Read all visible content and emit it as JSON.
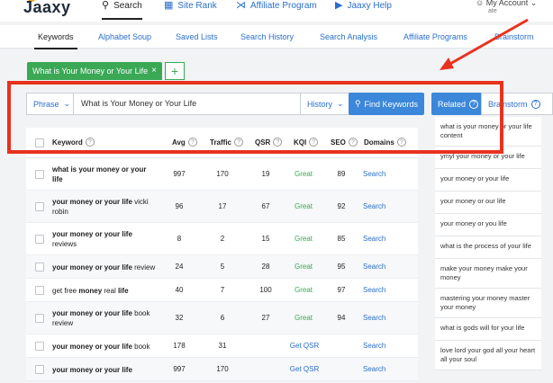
{
  "brand": {
    "name": "Jaaxy"
  },
  "topnav": [
    {
      "label": "Search",
      "icon": "search-icon",
      "active": true
    },
    {
      "label": "Site Rank",
      "icon": "bar-chart-icon",
      "active": false
    },
    {
      "label": "Affiliate Program",
      "icon": "share-icon",
      "active": false
    },
    {
      "label": "Jaaxy Help",
      "icon": "play-circle-icon",
      "active": false
    }
  ],
  "account": {
    "label": "My Account",
    "sub": "ate"
  },
  "subnav": [
    {
      "label": "Keywords",
      "active": true
    },
    {
      "label": "Alphabet Soup"
    },
    {
      "label": "Saved Lists"
    },
    {
      "label": "Search History"
    },
    {
      "label": "Search Analysis"
    },
    {
      "label": "Affiliate Programs"
    },
    {
      "label": "Brainstorm"
    }
  ],
  "query_tab": {
    "label": "What is Your Money or Your Life",
    "close": "×",
    "add": "+"
  },
  "search": {
    "mode": "Phrase",
    "value": "What is Your Money or Your Life",
    "history": "History",
    "button": "Find Keywords"
  },
  "side_tabs": {
    "related": "Related",
    "brainstorm": "Brainstorm"
  },
  "table": {
    "headers": {
      "keyword": "Keyword",
      "avg": "Avg",
      "traffic": "Traffic",
      "qsr": "QSR",
      "kqi": "KQI",
      "seo": "SEO",
      "domains": "Domains"
    },
    "rows": [
      {
        "kw_bold": "what is your money or your life",
        "kw_plain": "",
        "avg": "997",
        "traffic": "170",
        "qsr": "19",
        "kqi": "Great",
        "seo": "89",
        "domains": "Search"
      },
      {
        "kw_bold": "your money or your life",
        "kw_plain": " vicki robin",
        "avg": "96",
        "traffic": "17",
        "qsr": "67",
        "kqi": "Great",
        "seo": "92",
        "domains": "Search"
      },
      {
        "kw_bold": "your money or your life",
        "kw_plain": " reviews",
        "avg": "8",
        "traffic": "2",
        "qsr": "15",
        "kqi": "Great",
        "seo": "85",
        "domains": "Search"
      },
      {
        "kw_bold": "your money or your life",
        "kw_plain": " review",
        "avg": "24",
        "traffic": "5",
        "qsr": "28",
        "kqi": "Great",
        "seo": "95",
        "domains": "Search"
      },
      {
        "kw_pre": "get free ",
        "kw_bold": "money",
        "kw_mid": " real ",
        "kw_bold2": "life",
        "avg": "40",
        "traffic": "7",
        "qsr": "100",
        "kqi": "Great",
        "seo": "97",
        "domains": "Search"
      },
      {
        "kw_bold": "your money or your life",
        "kw_plain": " book review",
        "avg": "32",
        "traffic": "6",
        "qsr": "27",
        "kqi": "Great",
        "seo": "94",
        "domains": "Search"
      },
      {
        "kw_bold": "your money or your life",
        "kw_plain": " book",
        "avg": "178",
        "traffic": "31",
        "qsr": "Get QSR",
        "kqi": "",
        "seo": "",
        "domains": "Search"
      },
      {
        "kw_bold": "your money or your life",
        "kw_plain": "",
        "avg": "997",
        "traffic": "170",
        "qsr": "Get QSR",
        "kqi": "",
        "seo": "",
        "domains": "Search"
      }
    ]
  },
  "related": [
    "what is your money or your life content",
    "ymyl your money or your life",
    "your money or your life",
    "your money or our life",
    "your money or you life",
    "what is the process of your life",
    "make your money make your money",
    "mastering your money master your money",
    "what is gods will for your life",
    "love lord your god all your heart all your soul"
  ],
  "colors": {
    "accent": "#3b87d9",
    "green": "#3aa855",
    "annotation": "#e8321e"
  }
}
